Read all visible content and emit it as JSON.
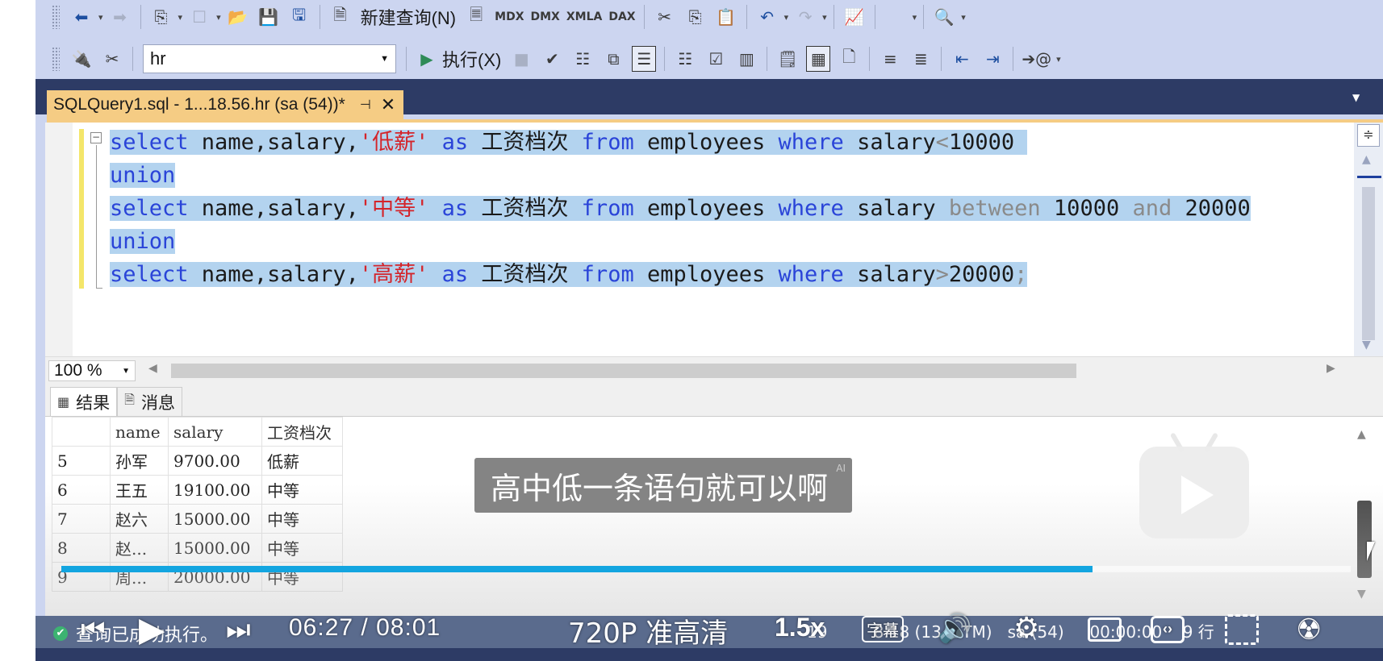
{
  "toolbar1": {
    "new_query_label": "新建查询(N)",
    "mdx_label": "MDX",
    "dmx_label": "DMX",
    "xmla_label": "XMLA",
    "dax_label": "DAX"
  },
  "toolbar2": {
    "database": "hr",
    "execute_label": "执行(X)"
  },
  "doc_tab": {
    "title": "SQLQuery1.sql - 1...18.56.hr (sa (54))*"
  },
  "editor": {
    "lines": [
      {
        "kw1": "select",
        "cols": " name,salary,",
        "str": "'低薪'",
        "as": " as ",
        "alias": "工资档次",
        "from": " from ",
        "table": "employees",
        "where": " where ",
        "col": "salary",
        "op": "<",
        "val": "10000",
        "tail": " "
      },
      {
        "union": "union"
      },
      {
        "kw1": "select",
        "cols": " name,salary,",
        "str": "'中等'",
        "as": " as ",
        "alias": "工资档次",
        "from": " from ",
        "table": "employees",
        "where": " where ",
        "col": "salary ",
        "op": "between",
        "val": " 10000 ",
        "op2": "and",
        "val2": " 20000"
      },
      {
        "union": "union"
      },
      {
        "kw1": "select",
        "cols": " name,salary,",
        "str": "'高薪'",
        "as": " as ",
        "alias": "工资档次",
        "from": " from ",
        "table": "employees",
        "where": " where ",
        "col": "salary",
        "op": ">",
        "val": "20000",
        "tail": ";"
      }
    ]
  },
  "zoom": "100 %",
  "result_tabs": {
    "results": "结果",
    "messages": "消息"
  },
  "grid": {
    "headers": [
      "",
      "name",
      "salary",
      "工资档次"
    ],
    "rows": [
      [
        "5",
        "孙军",
        "9700.00",
        "低薪"
      ],
      [
        "6",
        "王五",
        "19100.00",
        "中等"
      ],
      [
        "7",
        "赵六",
        "15000.00",
        "中等"
      ],
      [
        "8",
        "赵...",
        "15000.00",
        "中等"
      ],
      [
        "9",
        "周...",
        "20000.00",
        "中等"
      ]
    ]
  },
  "status": {
    "message": "查询已成功执行。",
    "right_text": "19         8.18 (13.   TM)   sa (54)     00:00:00    9 行"
  },
  "video": {
    "subtitle": "高中低一条语句就可以啊",
    "subtitle_badge": "AI",
    "current_time": "06:27",
    "total_time": "08:01",
    "time_separator": "/",
    "quality": "720P 准高清",
    "speed": "1.5x",
    "cc_label": "字幕",
    "progress": 0.8,
    "progress_color": "#13a5e0"
  },
  "colors": {
    "keyword": "#2a44d8",
    "string": "#d4242a",
    "selection": "#b3d3ef",
    "tab_active": "#f5cc84",
    "toolbar_bg": "#ccd5f0",
    "status_bg": "#5a6b8d"
  },
  "icons": {
    "back": "back-arrow-icon",
    "new_file": "new-file-icon",
    "open": "open-folder-icon",
    "save": "save-icon",
    "save_all": "save-all-icon",
    "execute": "play-triangle-icon",
    "parse": "checkmark-icon",
    "cut": "scissors-icon",
    "undo": "undo-icon",
    "redo": "redo-icon"
  }
}
